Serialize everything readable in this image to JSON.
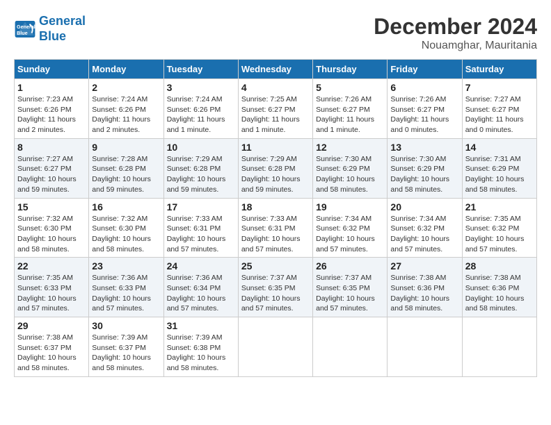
{
  "logo": {
    "line1": "General",
    "line2": "Blue"
  },
  "title": "December 2024",
  "location": "Nouamghar, Mauritania",
  "weekdays": [
    "Sunday",
    "Monday",
    "Tuesday",
    "Wednesday",
    "Thursday",
    "Friday",
    "Saturday"
  ],
  "weeks": [
    [
      {
        "day": "1",
        "sunrise": "7:23 AM",
        "sunset": "6:26 PM",
        "daylight": "11 hours and 2 minutes."
      },
      {
        "day": "2",
        "sunrise": "7:24 AM",
        "sunset": "6:26 PM",
        "daylight": "11 hours and 2 minutes."
      },
      {
        "day": "3",
        "sunrise": "7:24 AM",
        "sunset": "6:26 PM",
        "daylight": "11 hours and 1 minute."
      },
      {
        "day": "4",
        "sunrise": "7:25 AM",
        "sunset": "6:27 PM",
        "daylight": "11 hours and 1 minute."
      },
      {
        "day": "5",
        "sunrise": "7:26 AM",
        "sunset": "6:27 PM",
        "daylight": "11 hours and 1 minute."
      },
      {
        "day": "6",
        "sunrise": "7:26 AM",
        "sunset": "6:27 PM",
        "daylight": "11 hours and 0 minutes."
      },
      {
        "day": "7",
        "sunrise": "7:27 AM",
        "sunset": "6:27 PM",
        "daylight": "11 hours and 0 minutes."
      }
    ],
    [
      {
        "day": "8",
        "sunrise": "7:27 AM",
        "sunset": "6:27 PM",
        "daylight": "10 hours and 59 minutes."
      },
      {
        "day": "9",
        "sunrise": "7:28 AM",
        "sunset": "6:28 PM",
        "daylight": "10 hours and 59 minutes."
      },
      {
        "day": "10",
        "sunrise": "7:29 AM",
        "sunset": "6:28 PM",
        "daylight": "10 hours and 59 minutes."
      },
      {
        "day": "11",
        "sunrise": "7:29 AM",
        "sunset": "6:28 PM",
        "daylight": "10 hours and 59 minutes."
      },
      {
        "day": "12",
        "sunrise": "7:30 AM",
        "sunset": "6:29 PM",
        "daylight": "10 hours and 58 minutes."
      },
      {
        "day": "13",
        "sunrise": "7:30 AM",
        "sunset": "6:29 PM",
        "daylight": "10 hours and 58 minutes."
      },
      {
        "day": "14",
        "sunrise": "7:31 AM",
        "sunset": "6:29 PM",
        "daylight": "10 hours and 58 minutes."
      }
    ],
    [
      {
        "day": "15",
        "sunrise": "7:32 AM",
        "sunset": "6:30 PM",
        "daylight": "10 hours and 58 minutes."
      },
      {
        "day": "16",
        "sunrise": "7:32 AM",
        "sunset": "6:30 PM",
        "daylight": "10 hours and 58 minutes."
      },
      {
        "day": "17",
        "sunrise": "7:33 AM",
        "sunset": "6:31 PM",
        "daylight": "10 hours and 57 minutes."
      },
      {
        "day": "18",
        "sunrise": "7:33 AM",
        "sunset": "6:31 PM",
        "daylight": "10 hours and 57 minutes."
      },
      {
        "day": "19",
        "sunrise": "7:34 AM",
        "sunset": "6:32 PM",
        "daylight": "10 hours and 57 minutes."
      },
      {
        "day": "20",
        "sunrise": "7:34 AM",
        "sunset": "6:32 PM",
        "daylight": "10 hours and 57 minutes."
      },
      {
        "day": "21",
        "sunrise": "7:35 AM",
        "sunset": "6:32 PM",
        "daylight": "10 hours and 57 minutes."
      }
    ],
    [
      {
        "day": "22",
        "sunrise": "7:35 AM",
        "sunset": "6:33 PM",
        "daylight": "10 hours and 57 minutes."
      },
      {
        "day": "23",
        "sunrise": "7:36 AM",
        "sunset": "6:33 PM",
        "daylight": "10 hours and 57 minutes."
      },
      {
        "day": "24",
        "sunrise": "7:36 AM",
        "sunset": "6:34 PM",
        "daylight": "10 hours and 57 minutes."
      },
      {
        "day": "25",
        "sunrise": "7:37 AM",
        "sunset": "6:35 PM",
        "daylight": "10 hours and 57 minutes."
      },
      {
        "day": "26",
        "sunrise": "7:37 AM",
        "sunset": "6:35 PM",
        "daylight": "10 hours and 57 minutes."
      },
      {
        "day": "27",
        "sunrise": "7:38 AM",
        "sunset": "6:36 PM",
        "daylight": "10 hours and 58 minutes."
      },
      {
        "day": "28",
        "sunrise": "7:38 AM",
        "sunset": "6:36 PM",
        "daylight": "10 hours and 58 minutes."
      }
    ],
    [
      {
        "day": "29",
        "sunrise": "7:38 AM",
        "sunset": "6:37 PM",
        "daylight": "10 hours and 58 minutes."
      },
      {
        "day": "30",
        "sunrise": "7:39 AM",
        "sunset": "6:37 PM",
        "daylight": "10 hours and 58 minutes."
      },
      {
        "day": "31",
        "sunrise": "7:39 AM",
        "sunset": "6:38 PM",
        "daylight": "10 hours and 58 minutes."
      },
      null,
      null,
      null,
      null
    ]
  ],
  "labels": {
    "sunrise": "Sunrise:",
    "sunset": "Sunset:",
    "daylight": "Daylight:"
  },
  "accent_color": "#1a6faf"
}
